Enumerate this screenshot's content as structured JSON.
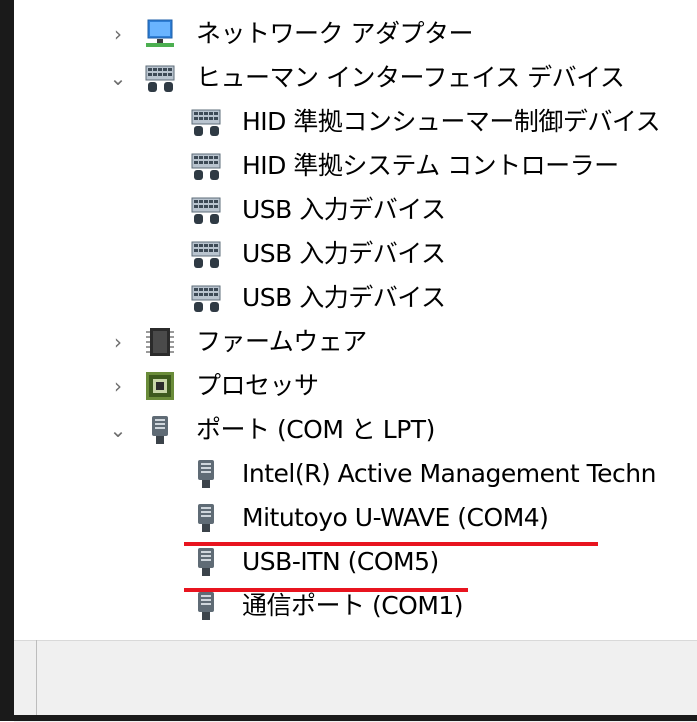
{
  "tree": {
    "network_adapters": {
      "label": "ネットワーク アダプター",
      "icon": "network-adapter-icon",
      "state": "collapsed"
    },
    "human_interface_devices": {
      "label": "ヒューマン インターフェイス デバイス",
      "icon": "hid-keyboard-icon",
      "state": "expanded",
      "children": [
        {
          "label": "HID 準拠コンシューマー制御デバイス",
          "icon": "hid-keyboard-icon"
        },
        {
          "label": "HID 準拠システム コントローラー",
          "icon": "hid-keyboard-icon"
        },
        {
          "label": "USB 入力デバイス",
          "icon": "hid-keyboard-icon"
        },
        {
          "label": "USB 入力デバイス",
          "icon": "hid-keyboard-icon"
        },
        {
          "label": "USB 入力デバイス",
          "icon": "hid-keyboard-icon"
        }
      ]
    },
    "firmware": {
      "label": "ファームウェア",
      "icon": "firmware-chip-icon",
      "state": "collapsed"
    },
    "processors": {
      "label": "プロセッサ",
      "icon": "processor-icon",
      "state": "collapsed"
    },
    "ports": {
      "label": "ポート (COM と LPT)",
      "icon": "port-connector-icon",
      "state": "expanded",
      "children": [
        {
          "label": "Intel(R) Active Management Techn",
          "icon": "port-connector-icon",
          "highlighted": false
        },
        {
          "label": "Mitutoyo U-WAVE (COM4)",
          "icon": "port-connector-icon",
          "highlighted": true
        },
        {
          "label": "USB-ITN (COM5)",
          "icon": "port-connector-icon",
          "highlighted": true
        },
        {
          "label": "通信ポート (COM1)",
          "icon": "port-connector-icon",
          "highlighted": false
        }
      ]
    }
  },
  "colors": {
    "highlight_underline": "#e8141f",
    "status_bar": "#f0f0f0",
    "window_frame": "#1a1a1a"
  }
}
